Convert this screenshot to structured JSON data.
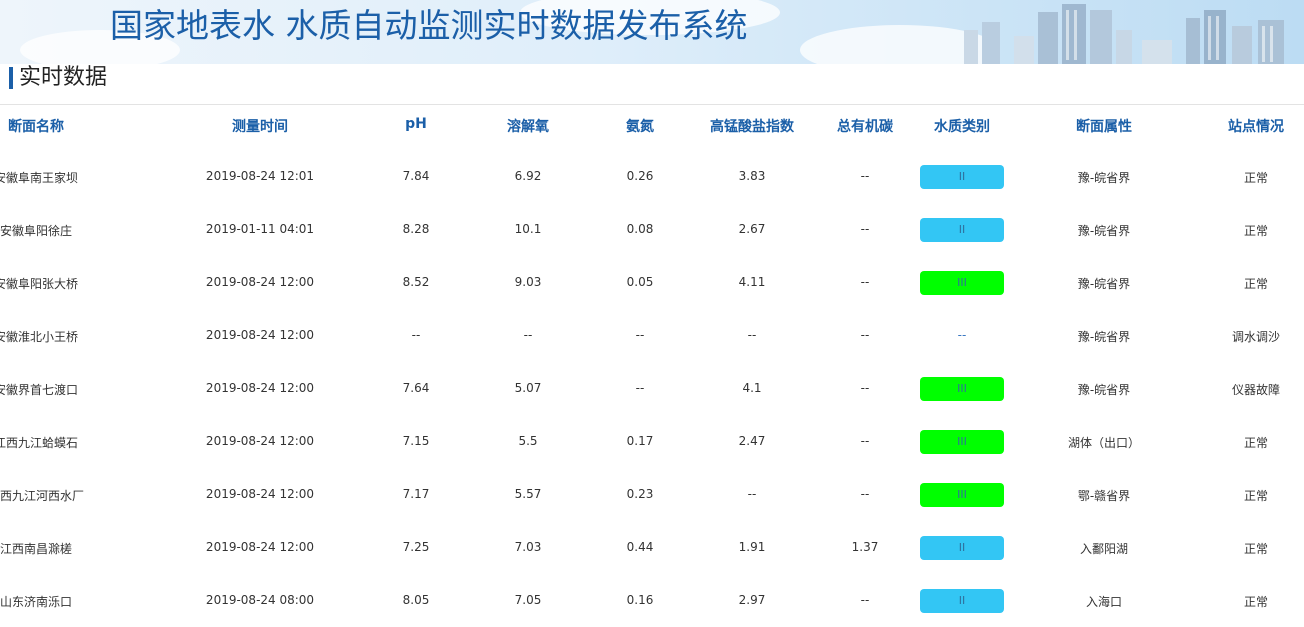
{
  "header": {
    "title": "国家地表水 水质自动监测实时数据发布系统"
  },
  "section": {
    "title": "实时数据"
  },
  "colors": {
    "class_II": "#33c6f4",
    "class_III": "#00ff00",
    "header_blue": "#1b5fa8"
  },
  "table": {
    "columns": [
      "断面名称",
      "测量时间",
      "pH",
      "溶解氧",
      "氨氮",
      "高锰酸盐指数",
      "总有机碳",
      "水质类别",
      "断面属性",
      "站点情况"
    ],
    "rows": [
      {
        "name": "安徽阜南王家坝",
        "time": "2019-08-24 12:01",
        "ph": "7.84",
        "do": "6.92",
        "nh": "0.26",
        "mn": "3.83",
        "toc": "--",
        "grade": "II",
        "grade_type": "II",
        "attr": "豫-皖省界",
        "status": "正常"
      },
      {
        "name": "安徽阜阳徐庄",
        "time": "2019-01-11 04:01",
        "ph": "8.28",
        "do": "10.1",
        "nh": "0.08",
        "mn": "2.67",
        "toc": "--",
        "grade": "II",
        "grade_type": "II",
        "attr": "豫-皖省界",
        "status": "正常"
      },
      {
        "name": "安徽阜阳张大桥",
        "time": "2019-08-24 12:00",
        "ph": "8.52",
        "do": "9.03",
        "nh": "0.05",
        "mn": "4.11",
        "toc": "--",
        "grade": "III",
        "grade_type": "III",
        "attr": "豫-皖省界",
        "status": "正常"
      },
      {
        "name": "安徽淮北小王桥",
        "time": "2019-08-24 12:00",
        "ph": "--",
        "do": "--",
        "nh": "--",
        "mn": "--",
        "toc": "--",
        "grade": "--",
        "grade_type": "none",
        "attr": "豫-皖省界",
        "status": "调水调沙"
      },
      {
        "name": "安徽界首七渡口",
        "time": "2019-08-24 12:00",
        "ph": "7.64",
        "do": "5.07",
        "nh": "--",
        "mn": "4.1",
        "toc": "--",
        "grade": "III",
        "grade_type": "III",
        "attr": "豫-皖省界",
        "status": "仪器故障"
      },
      {
        "name": "江西九江蛤蟆石",
        "time": "2019-08-24 12:00",
        "ph": "7.15",
        "do": "5.5",
        "nh": "0.17",
        "mn": "2.47",
        "toc": "--",
        "grade": "III",
        "grade_type": "III",
        "attr": "湖体（出口）",
        "status": "正常"
      },
      {
        "name": "江西九江河西水厂",
        "time": "2019-08-24 12:00",
        "ph": "7.17",
        "do": "5.57",
        "nh": "0.23",
        "mn": "--",
        "toc": "--",
        "grade": "III",
        "grade_type": "III",
        "attr": "鄂-赣省界",
        "status": "正常"
      },
      {
        "name": "江西南昌滁槎",
        "time": "2019-08-24 12:00",
        "ph": "7.25",
        "do": "7.03",
        "nh": "0.44",
        "mn": "1.91",
        "toc": "1.37",
        "grade": "II",
        "grade_type": "II",
        "attr": "入鄱阳湖",
        "status": "正常"
      },
      {
        "name": "山东济南泺口",
        "time": "2019-08-24 08:00",
        "ph": "8.05",
        "do": "7.05",
        "nh": "0.16",
        "mn": "2.97",
        "toc": "--",
        "grade": "II",
        "grade_type": "II",
        "attr": "入海口",
        "status": "正常"
      }
    ]
  }
}
